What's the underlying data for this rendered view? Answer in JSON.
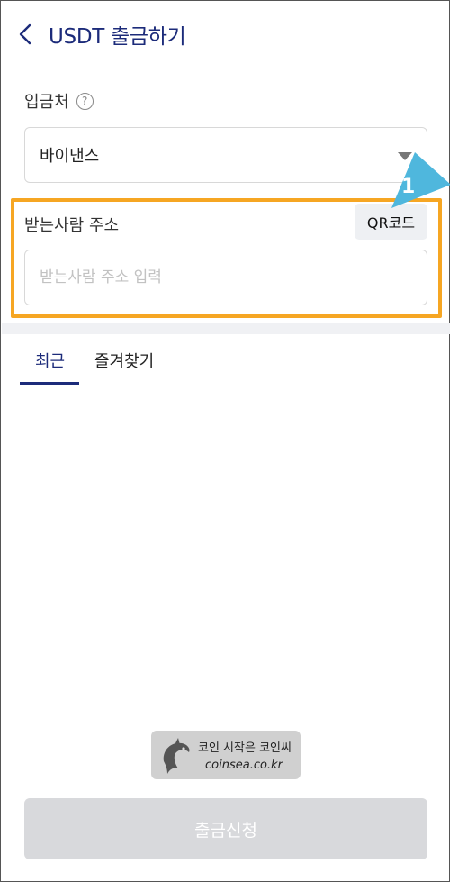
{
  "header": {
    "title": "USDT 출금하기"
  },
  "destination": {
    "label": "입금처",
    "help_symbol": "?",
    "selected_value": "바이낸스"
  },
  "recipient": {
    "label": "받는사람 주소",
    "qr_button_label": "QR코드",
    "address_placeholder": "받는사람 주소 입력",
    "address_value": ""
  },
  "annotation": {
    "step_number": "1",
    "highlight_color": "#f6a623",
    "arrow_color": "#4fb7dd"
  },
  "tabs": [
    {
      "label": "최근",
      "active": true
    },
    {
      "label": "즐겨찾기",
      "active": false
    }
  ],
  "watermark": {
    "line1": "코인 시작은 코인씨",
    "line2": "coinsea.co.kr"
  },
  "footer": {
    "submit_label": "출금신청"
  },
  "colors": {
    "brand": "#1c2b7a",
    "disabled_button": "#d8d9dc"
  },
  "icons": {
    "back": "chevron-left-icon",
    "help": "question-circle-icon",
    "dropdown": "caret-down-icon"
  }
}
